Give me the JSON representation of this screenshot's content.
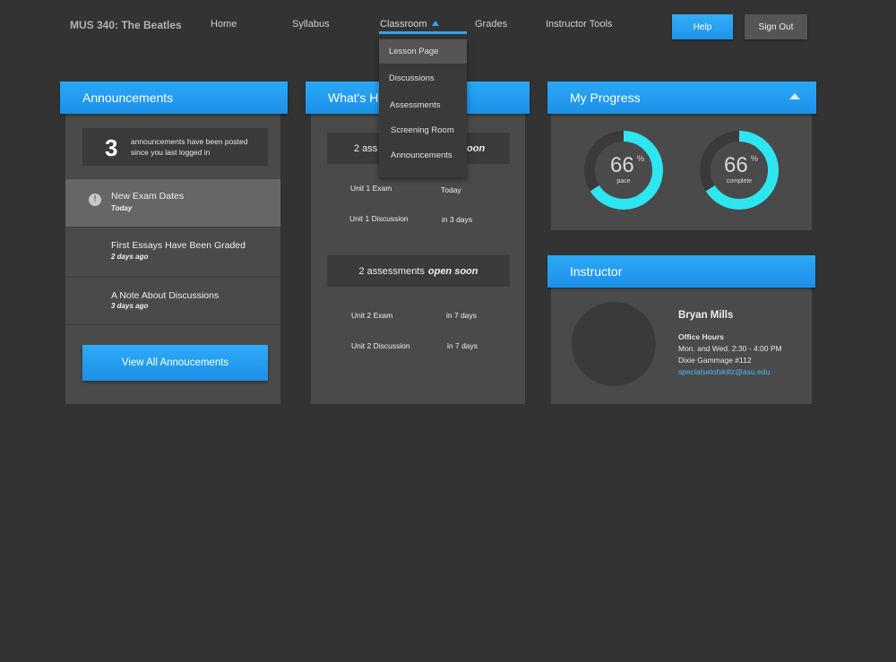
{
  "nav": {
    "course_title": "MUS 340: The Beatles",
    "home": "Home",
    "syllabus": "Syllabus",
    "classroom": "Classroom",
    "grades": "Grades",
    "instructor_tools": "Instructor Tools",
    "help": "Help",
    "sign_out": "Sign Out"
  },
  "classroom_menu": {
    "items": [
      "Lesson Page",
      "Discussions",
      "Assessments",
      "Screening Room",
      "Announcements"
    ],
    "active": "Lesson Page"
  },
  "announcements": {
    "title": "Announcements",
    "count": "3",
    "count_text": "announcements have been posted since you last logged in",
    "items": [
      {
        "title": "New Exam Dates",
        "date": "Today",
        "alert": true
      },
      {
        "title": "First Essays Have Been Graded",
        "date": "2 days ago",
        "alert": false
      },
      {
        "title": "A Note About Discussions",
        "date": "3 days ago",
        "alert": false
      }
    ],
    "view_all": "View All Annoucements"
  },
  "whats_happening": {
    "title": "What's H",
    "groups": [
      {
        "count_text": "2 ass",
        "status": "oon",
        "rows": [
          {
            "name": "Unit 1 Exam",
            "when": "Today"
          },
          {
            "name": "Unit 1 Discussion",
            "when": "in 3 days"
          }
        ]
      },
      {
        "count_text": "2 assessments",
        "status": "open soon",
        "rows": [
          {
            "name": "Unit 2 Exam",
            "when": "in 7 days"
          },
          {
            "name": "Unit 2 Discussion",
            "when": "in 7 days"
          }
        ]
      }
    ]
  },
  "progress": {
    "title": "My Progress",
    "rings": [
      {
        "value": "66",
        "unit": "%",
        "label": "pace",
        "fraction": 0.66
      },
      {
        "value": "66",
        "unit": "%",
        "label": "complete",
        "fraction": 0.66
      }
    ],
    "ring_color": "#2ee6f0",
    "track_color": "#3a3a3a"
  },
  "instructor": {
    "title": "Instructor",
    "name": "Bryan Mills",
    "office_hours_label": "Office Hours",
    "hours": "Mon. and Wed. 2:30 - 4:00 PM",
    "location": "Dixie Gammage #112",
    "email": "specialsetofskillz@asu.edu"
  },
  "colors": {
    "accent": "#2aa8f7",
    "background": "#333333",
    "panel": "#4a4a4a"
  }
}
